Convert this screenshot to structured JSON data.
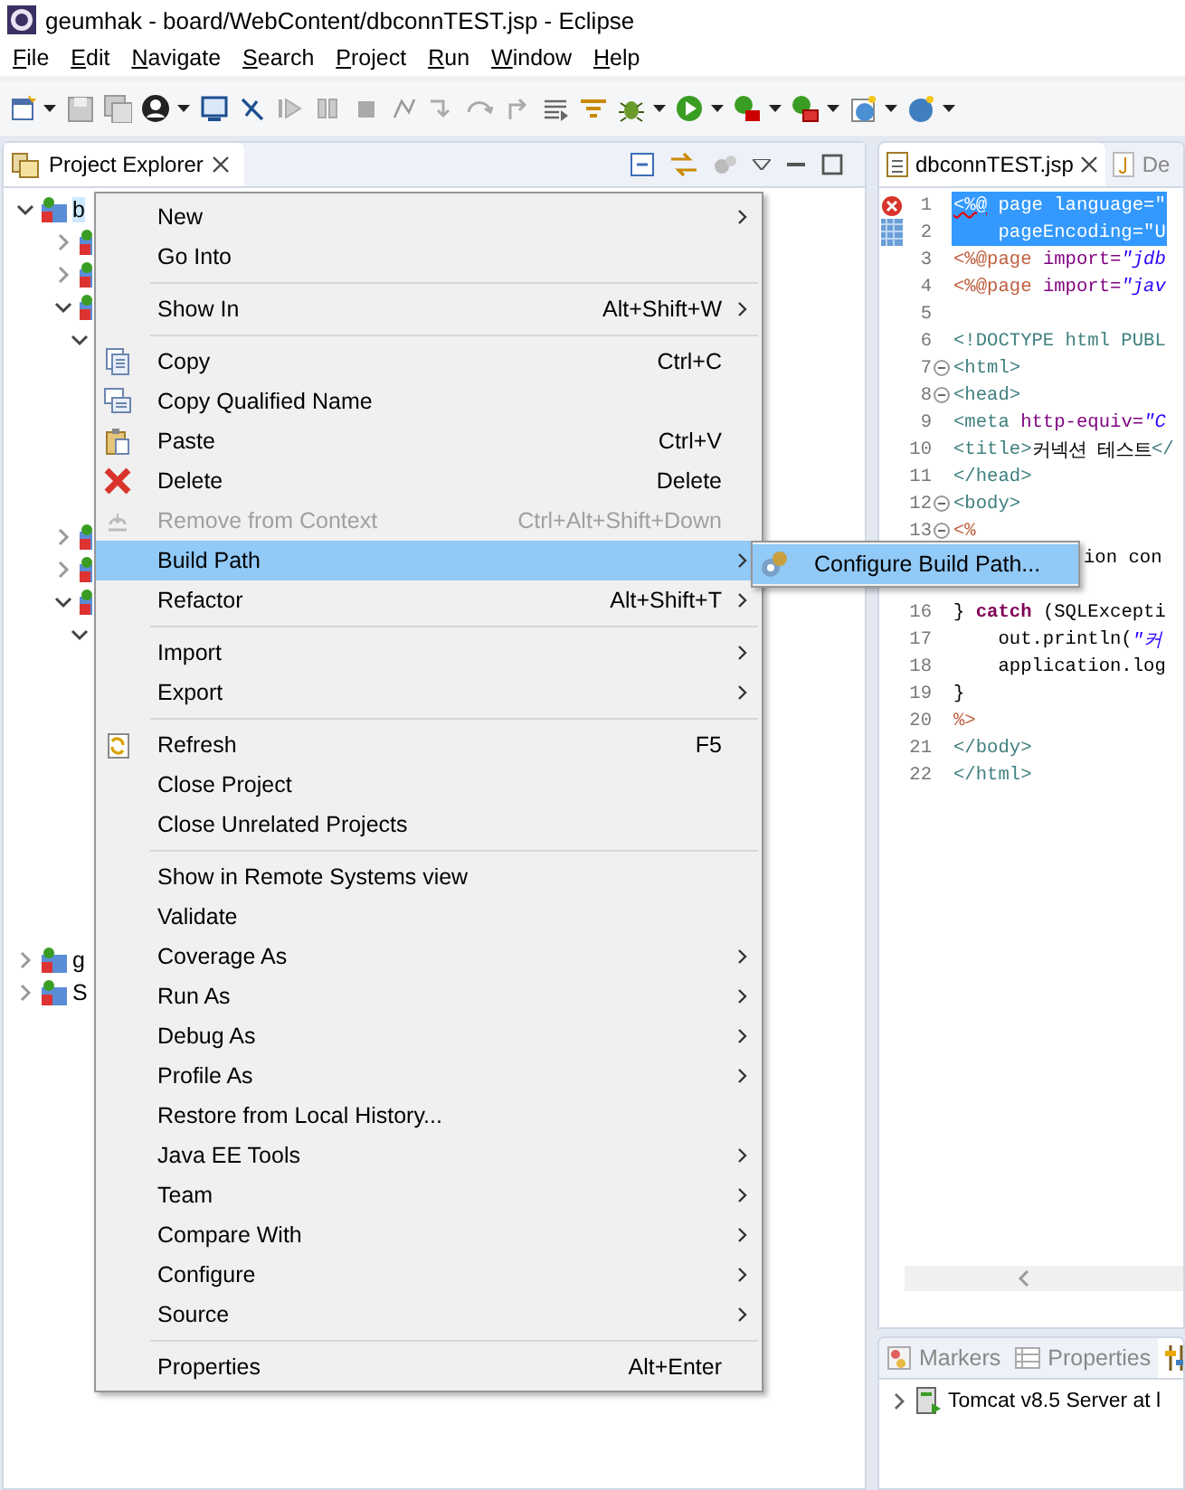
{
  "window": {
    "title": "geumhak - board/WebContent/dbconnTEST.jsp - Eclipse"
  },
  "menu_bar": [
    "File",
    "Edit",
    "Navigate",
    "Search",
    "Project",
    "Run",
    "Window",
    "Help"
  ],
  "project_explorer": {
    "tab": {
      "label": "Project Explorer",
      "selected": true
    },
    "tree": [
      {
        "label": "b",
        "expanded": true,
        "selected": true,
        "children": [
          {
            "expanded": false
          },
          {
            "expanded": false
          },
          {
            "expanded": true,
            "children": [
              {
                "expanded": true
              }
            ]
          },
          {
            "expanded": false
          },
          {
            "expanded": false
          },
          {
            "expanded": true,
            "children": [
              {
                "expanded": true
              }
            ]
          }
        ]
      },
      {
        "label": "g",
        "expanded": false,
        "selected": false
      },
      {
        "label": "S",
        "expanded": false,
        "selected": false
      }
    ]
  },
  "editor": {
    "tabs": [
      {
        "label": "dbconnTEST.jsp",
        "selected": true
      },
      {
        "label": "De",
        "selected": false
      }
    ],
    "lines": [
      {
        "number": "1",
        "selected": true,
        "error": true,
        "segments": [
          {
            "text": "<%@",
            "kind": "jsp"
          },
          {
            "text": " page ",
            "kind": "text"
          },
          {
            "text": "language=\"",
            "kind": "attr"
          }
        ]
      },
      {
        "number": "2",
        "selected": true,
        "error": false,
        "segments": [
          {
            "text": "    pageEncoding=\"U",
            "kind": "attr"
          }
        ]
      },
      {
        "number": "3",
        "selected": false,
        "error": false,
        "segments": [
          {
            "text": "<%@page ",
            "kind": "jsp"
          },
          {
            "text": "import=",
            "kind": "attr"
          },
          {
            "text": "\"jdb",
            "kind": "string"
          }
        ]
      },
      {
        "number": "4",
        "selected": false,
        "error": false,
        "segments": [
          {
            "text": "<%@page ",
            "kind": "jsp"
          },
          {
            "text": "import=",
            "kind": "attr"
          },
          {
            "text": "\"jav",
            "kind": "string"
          }
        ]
      },
      {
        "number": "5",
        "selected": false,
        "error": false
      },
      {
        "number": "6",
        "selected": false,
        "error": false,
        "segments": [
          {
            "text": "<!DOCTYPE html PUBL",
            "kind": "tag"
          }
        ]
      },
      {
        "number": "7",
        "selected": false,
        "error": false,
        "fold": true,
        "segments": [
          {
            "text": "<html>",
            "kind": "tag"
          }
        ]
      },
      {
        "number": "8",
        "selected": false,
        "error": false,
        "fold": true,
        "segments": [
          {
            "text": "<head>",
            "kind": "tag"
          }
        ]
      },
      {
        "number": "9",
        "selected": false,
        "error": false,
        "segments": [
          {
            "text": "<meta ",
            "kind": "tag"
          },
          {
            "text": "http-equiv=",
            "kind": "attr"
          },
          {
            "text": "\"C",
            "kind": "string"
          }
        ]
      },
      {
        "number": "10",
        "selected": false,
        "error": false,
        "segments": [
          {
            "text": "<title>",
            "kind": "tag"
          },
          {
            "text": "커넥션 테스트",
            "kind": "text"
          },
          {
            "text": "</",
            "kind": "tag"
          }
        ]
      },
      {
        "number": "11",
        "selected": false,
        "error": false,
        "segments": [
          {
            "text": "</head>",
            "kind": "tag"
          }
        ]
      },
      {
        "number": "12",
        "selected": false,
        "error": false,
        "fold": true,
        "segments": [
          {
            "text": "<body>",
            "kind": "tag"
          }
        ]
      },
      {
        "number": "13",
        "selected": false,
        "error": false,
        "fold": true,
        "segments": [
          {
            "text": "<%",
            "kind": "jsp"
          }
        ]
      },
      {
        "selected": false,
        "error": false,
        "covered": true,
        "segments": [
          {
            "text": "ion con",
            "kind": "text"
          }
        ]
      },
      {
        "selected": false,
        "error": false
      },
      {
        "number": "16",
        "selected": false,
        "error": false,
        "segments": [
          {
            "text": "} ",
            "kind": "text"
          },
          {
            "text": "catch",
            "kind": "keyword"
          },
          {
            "text": " (SQLExcepti",
            "kind": "text"
          }
        ]
      },
      {
        "number": "17",
        "selected": false,
        "error": false,
        "segments": [
          {
            "text": "    out.println(",
            "kind": "text"
          },
          {
            "text": "\"커",
            "kind": "string"
          }
        ]
      },
      {
        "number": "18",
        "selected": false,
        "error": false,
        "segments": [
          {
            "text": "    application.log",
            "kind": "text"
          }
        ]
      },
      {
        "number": "19",
        "selected": false,
        "error": false,
        "segments": [
          {
            "text": "}",
            "kind": "text"
          }
        ]
      },
      {
        "number": "20",
        "selected": false,
        "error": false,
        "segments": [
          {
            "text": "%>",
            "kind": "jsp"
          }
        ]
      },
      {
        "number": "21",
        "selected": false,
        "error": false,
        "segments": [
          {
            "text": "</body>",
            "kind": "tag"
          }
        ]
      },
      {
        "number": "22",
        "selected": false,
        "error": false,
        "segments": [
          {
            "text": "</html>",
            "kind": "tag"
          }
        ]
      }
    ]
  },
  "bottom_panel": {
    "tabs": [
      {
        "label": "Markers",
        "selected": false
      },
      {
        "label": "Properties",
        "selected": false
      },
      {
        "selected": true
      }
    ],
    "servers": [
      {
        "label": "Tomcat v8.5 Server at l",
        "expanded": false
      }
    ]
  },
  "context_menu": {
    "items": [
      {
        "kind": "item",
        "label": "New",
        "submenu": true,
        "disabled": false,
        "selected": false
      },
      {
        "kind": "item",
        "label": "Go Into",
        "submenu": false,
        "disabled": false,
        "selected": false
      },
      {
        "kind": "separator"
      },
      {
        "kind": "item",
        "label": "Show In",
        "shortcut": "Alt+Shift+W",
        "submenu": true,
        "disabled": false,
        "selected": false
      },
      {
        "kind": "separator"
      },
      {
        "kind": "item",
        "label": "Copy",
        "shortcut": "Ctrl+C",
        "submenu": false,
        "disabled": false,
        "selected": false
      },
      {
        "kind": "item",
        "label": "Copy Qualified Name",
        "submenu": false,
        "disabled": false,
        "selected": false
      },
      {
        "kind": "item",
        "label": "Paste",
        "shortcut": "Ctrl+V",
        "submenu": false,
        "disabled": false,
        "selected": false
      },
      {
        "kind": "item",
        "label": "Delete",
        "shortcut": "Delete",
        "submenu": false,
        "disabled": false,
        "selected": false
      },
      {
        "kind": "item",
        "label": "Remove from Context",
        "shortcut": "Ctrl+Alt+Shift+Down",
        "submenu": false,
        "disabled": true,
        "selected": false
      },
      {
        "kind": "item",
        "label": "Build Path",
        "submenu": true,
        "disabled": false,
        "selected": true
      },
      {
        "kind": "item",
        "label": "Refactor",
        "shortcut": "Alt+Shift+T",
        "submenu": true,
        "disabled": false,
        "selected": false
      },
      {
        "kind": "separator"
      },
      {
        "kind": "item",
        "label": "Import",
        "submenu": true,
        "disabled": false,
        "selected": false
      },
      {
        "kind": "item",
        "label": "Export",
        "submenu": true,
        "disabled": false,
        "selected": false
      },
      {
        "kind": "separator"
      },
      {
        "kind": "item",
        "label": "Refresh",
        "shortcut": "F5",
        "submenu": false,
        "disabled": false,
        "selected": false
      },
      {
        "kind": "item",
        "label": "Close Project",
        "submenu": false,
        "disabled": false,
        "selected": false
      },
      {
        "kind": "item",
        "label": "Close Unrelated Projects",
        "submenu": false,
        "disabled": false,
        "selected": false
      },
      {
        "kind": "separator"
      },
      {
        "kind": "item",
        "label": "Show in Remote Systems view",
        "submenu": false,
        "disabled": false,
        "selected": false
      },
      {
        "kind": "item",
        "label": "Validate",
        "submenu": false,
        "disabled": false,
        "selected": false
      },
      {
        "kind": "item",
        "label": "Coverage As",
        "submenu": true,
        "disabled": false,
        "selected": false
      },
      {
        "kind": "item",
        "label": "Run As",
        "submenu": true,
        "disabled": false,
        "selected": false
      },
      {
        "kind": "item",
        "label": "Debug As",
        "submenu": true,
        "disabled": false,
        "selected": false
      },
      {
        "kind": "item",
        "label": "Profile As",
        "submenu": true,
        "disabled": false,
        "selected": false
      },
      {
        "kind": "item",
        "label": "Restore from Local History...",
        "submenu": false,
        "disabled": false,
        "selected": false
      },
      {
        "kind": "item",
        "label": "Java EE Tools",
        "submenu": true,
        "disabled": false,
        "selected": false
      },
      {
        "kind": "item",
        "label": "Team",
        "submenu": true,
        "disabled": false,
        "selected": false
      },
      {
        "kind": "item",
        "label": "Compare With",
        "submenu": true,
        "disabled": false,
        "selected": false
      },
      {
        "kind": "item",
        "label": "Configure",
        "submenu": true,
        "disabled": false,
        "selected": false
      },
      {
        "kind": "item",
        "label": "Source",
        "submenu": true,
        "disabled": false,
        "selected": false
      },
      {
        "kind": "separator"
      },
      {
        "kind": "item",
        "label": "Properties",
        "shortcut": "Alt+Enter",
        "submenu": false,
        "disabled": false,
        "selected": false
      }
    ]
  },
  "submenu": {
    "items": [
      {
        "label": "Configure Build Path...",
        "selected": true
      }
    ]
  }
}
